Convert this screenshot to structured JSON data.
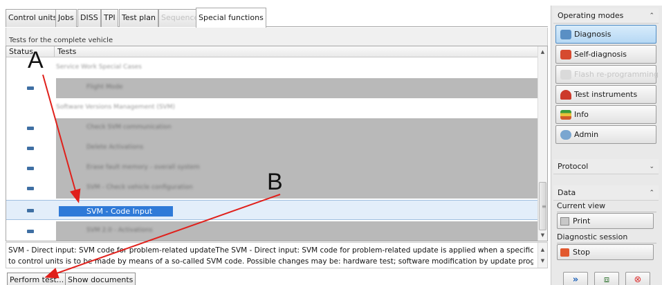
{
  "tabs": [
    {
      "label": "Control units",
      "state": "normal"
    },
    {
      "label": "Jobs",
      "state": "normal"
    },
    {
      "label": "DISS",
      "state": "normal"
    },
    {
      "label": "TPI",
      "state": "normal"
    },
    {
      "label": "Test plan",
      "state": "normal"
    },
    {
      "label": "Sequence",
      "state": "disabled"
    },
    {
      "label": "Special functions",
      "state": "active"
    }
  ],
  "section_title": "Tests for the complete vehicle",
  "grid": {
    "columns": [
      "Status",
      "Tests"
    ],
    "rows": [
      {
        "type": "group",
        "text": "Service Work Special Cases"
      },
      {
        "type": "item",
        "text": "Flight Mode"
      },
      {
        "type": "group",
        "text": "Software Versions Management (SVM)"
      },
      {
        "type": "item",
        "text": "Check SVM communication"
      },
      {
        "type": "item",
        "text": "Delete Activations"
      },
      {
        "type": "item",
        "text": "Erase fault memory - overall system"
      },
      {
        "type": "item",
        "text": "SVM - Check vehicle configuration"
      },
      {
        "type": "selected",
        "text": "SVM - Code Input"
      },
      {
        "type": "item",
        "text": "SVM 2.0 - Activations"
      }
    ]
  },
  "description": {
    "line1": "SVM - Direct input: SVM code for problem-related updateThe SVM - Direct input: SVM code for problem-related update is applied when a specific change",
    "line2": "to control units is to be made by means of a so-called SVM code. Possible changes may be: hardware test; software modification by update programming;"
  },
  "buttons": {
    "perform_test": "Perform test...",
    "show_documents": "Show documents"
  },
  "annotations": {
    "a": "A",
    "b": "B",
    "arrow_color": "#e0201b"
  },
  "right_panel": {
    "operating_modes_title": "Operating modes",
    "modes": [
      {
        "label": "Diagnosis",
        "state": "active",
        "icon": "stethoscope-icon"
      },
      {
        "label": "Self-diagnosis",
        "state": "normal",
        "icon": "self-diagnosis-icon"
      },
      {
        "label": "Flash re-programming",
        "state": "disabled",
        "icon": "flash-icon"
      },
      {
        "label": "Test instruments",
        "state": "normal",
        "icon": "gauge-icon"
      },
      {
        "label": "Info",
        "state": "normal",
        "icon": "books-icon"
      },
      {
        "label": "Admin",
        "state": "normal",
        "icon": "admin-gear-icon"
      }
    ],
    "protocol_title": "Protocol",
    "data_title": "Data",
    "current_view_title": "Current view",
    "print_label": "Print",
    "diagnostic_session_title": "Diagnostic session",
    "stop_label": "Stop"
  },
  "colors": {
    "selection": "#2f7ad8",
    "active_mode": "#b6d8f4",
    "status_dash": "#3f6fa3"
  }
}
